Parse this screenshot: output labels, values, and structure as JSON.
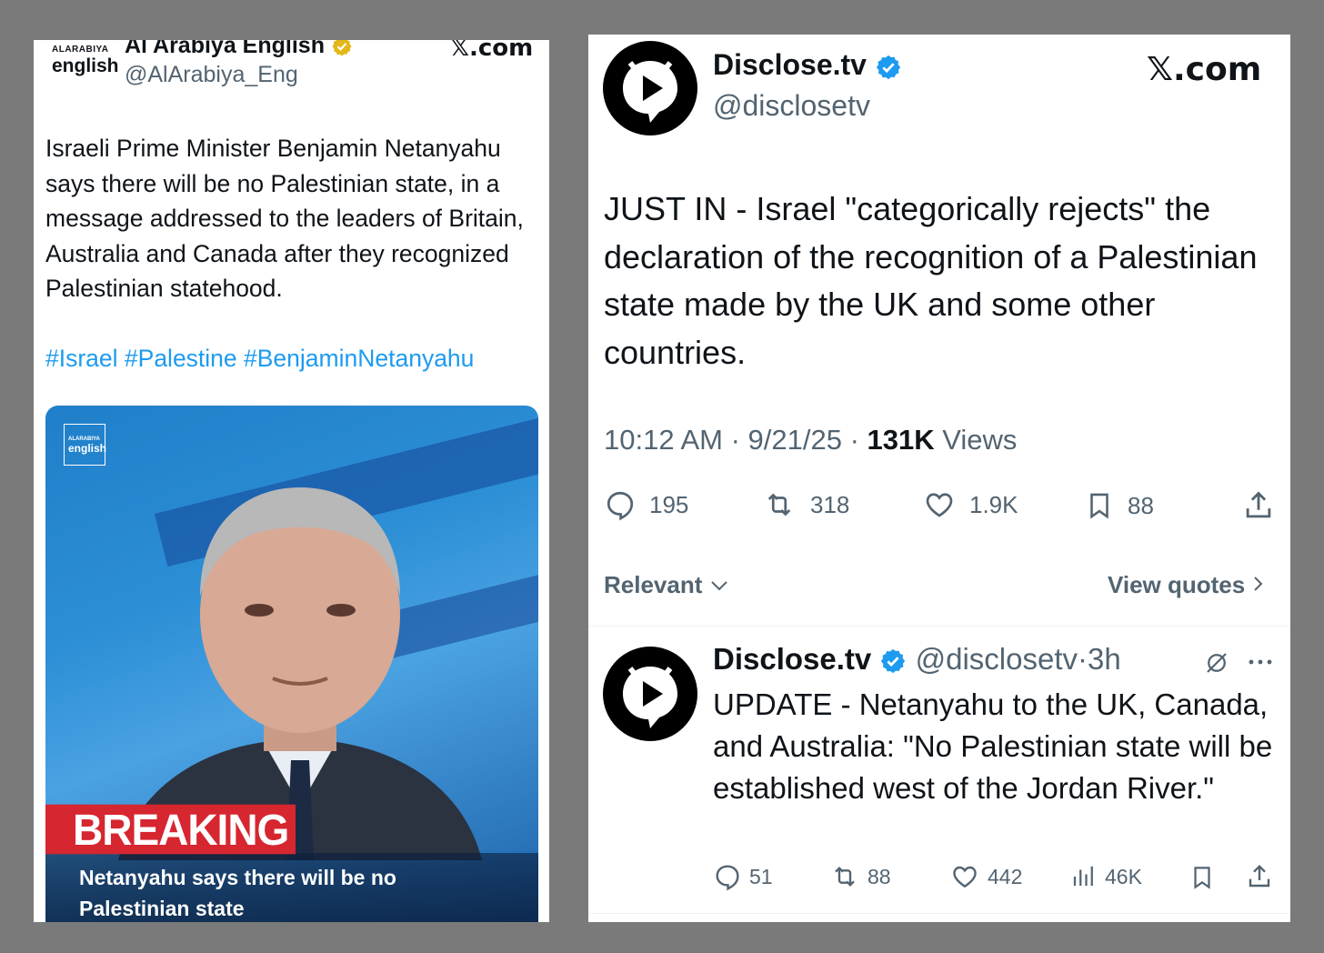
{
  "left_tweet": {
    "logo_line1": "ALARABIYA",
    "logo_line2": "english",
    "display_name": "Al Arabiya English",
    "handle": "@AlArabiya_Eng",
    "site": "𝕏.com",
    "text": "Israeli Prime Minister Benjamin Netanyahu says there will be no Palestinian state, in a message addressed to the leaders of Britain, Australia and Canada after they recognized Palestinian statehood.",
    "hashtags": "#Israel #Palestine #BenjaminNetanyahu",
    "media": {
      "logo_line1": "ALARABIYA",
      "logo_line2": "english",
      "badge": "BREAKING",
      "caption": "Netanyahu says there will be no Palestinian state"
    }
  },
  "right_tweet": {
    "display_name": "Disclose.tv",
    "handle": "@disclosetv",
    "site": "𝕏.com",
    "text": "JUST IN - Israel \"categorically rejects\" the declaration of the recognition of a Palestinian state made by the UK and some other countries.",
    "time": "10:12 AM · 9/21/25 · ",
    "views_count": "131K",
    "views_label": " Views",
    "stats": {
      "replies": "195",
      "reposts": "318",
      "likes": "1.9K",
      "bookmarks": "88"
    },
    "sort_label": "Relevant",
    "quotes_label": "View quotes",
    "reply": {
      "display_name": "Disclose.tv",
      "handle_time": "@disclosetv·3h",
      "text": "UPDATE - Netanyahu to the UK, Canada, and Australia: \"No Palestinian state will be established west of the Jordan River.\"",
      "stats": {
        "replies": "51",
        "reposts": "88",
        "likes": "442",
        "views": "46K"
      }
    }
  },
  "colors": {
    "verified_gold": "#e2b719",
    "verified_blue": "#1d9bf0",
    "link": "#1d9bf0",
    "breaking_red": "#d62630"
  }
}
